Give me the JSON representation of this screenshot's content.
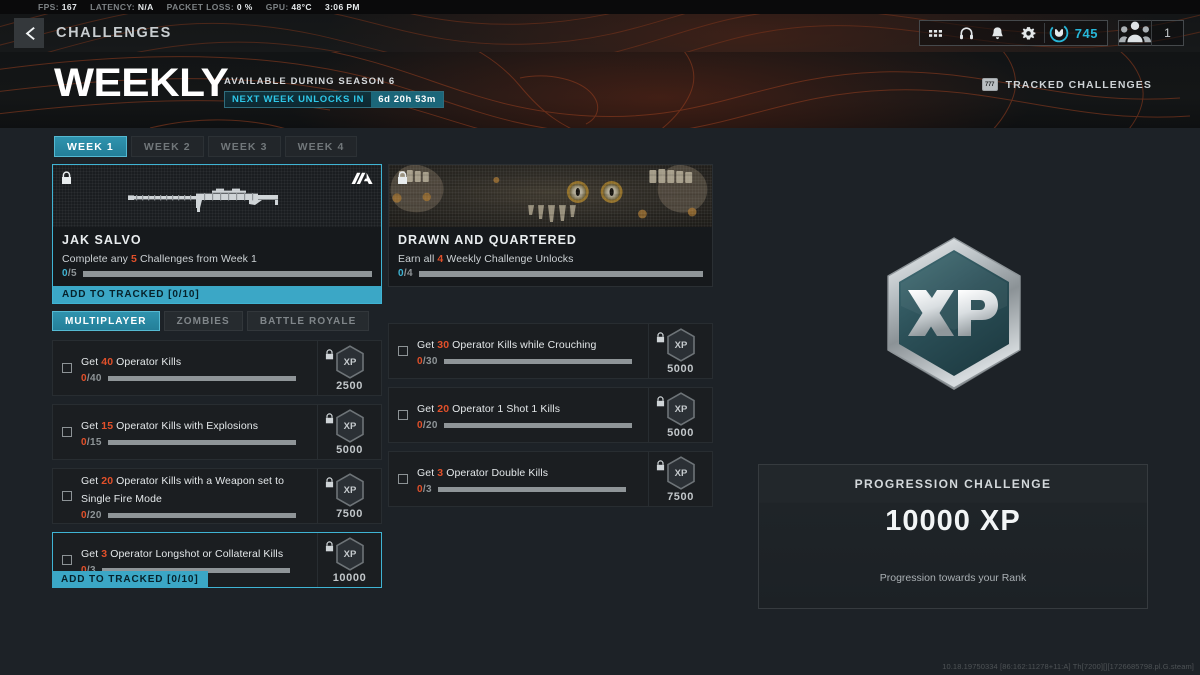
{
  "statusbar": {
    "fps_label": "FPS:",
    "fps_value": "167",
    "latency_label": "LATENCY:",
    "latency_value": "N/A",
    "packet_label": "PACKET LOSS:",
    "packet_value": "0 %",
    "gpu_label": "GPU:",
    "gpu_value": "48°C",
    "clock": "3:06 PM"
  },
  "header": {
    "back_icon": "chevron-left-icon",
    "title": "CHALLENGES",
    "icons": [
      "grid-apps-icon",
      "headphones-icon",
      "bell-icon",
      "gear-icon"
    ],
    "currency": {
      "icon": "cod-points-icon",
      "amount": "745"
    },
    "party": {
      "icon": "squad-icon",
      "count": "1"
    }
  },
  "hero": {
    "title": "WEEKLY",
    "availability": "AVAILABLE DURING SEASON 6",
    "timer_label": "NEXT WEEK UNLOCKS IN",
    "timer_value": "6d 20h 53m",
    "tracked_key": "777",
    "tracked_label": "TRACKED CHALLENGES"
  },
  "week_tabs": [
    {
      "label": "WEEK 1",
      "active": true
    },
    {
      "label": "WEEK 2",
      "active": false
    },
    {
      "label": "WEEK 3",
      "active": false
    },
    {
      "label": "WEEK 4",
      "active": false
    }
  ],
  "mode_tabs": [
    {
      "label": "MULTIPLAYER",
      "active": true
    },
    {
      "label": "ZOMBIES",
      "active": false
    },
    {
      "label": "BATTLE ROYALE",
      "active": false
    }
  ],
  "reward_cards": [
    {
      "name": "JAK SALVO",
      "description_pre": "Complete any ",
      "description_num": "5",
      "description_post": " Challenges from Week 1",
      "progress_current": "0",
      "progress_total": "/5",
      "progress_pct": 0,
      "lock_icon": "lock-icon",
      "rarity_icon": "rarity-badge-icon",
      "art": "weapon-jak-salvo",
      "selected": true,
      "track_label": "ADD TO TRACKED [0/10]"
    },
    {
      "name": "DRAWN AND QUARTERED",
      "description_pre": "Earn all ",
      "description_num": "4",
      "description_post": " Weekly Challenge Unlocks",
      "progress_current": "0",
      "progress_total": "/4",
      "progress_pct": 0,
      "lock_icon": "lock-icon",
      "art": "zombie-calling-card",
      "selected": false
    }
  ],
  "challenges_left": [
    {
      "title_pre": "Get ",
      "title_num": "40",
      "title_post": " Operator Kills",
      "progress_current": "0",
      "progress_total": "/40",
      "progress_pct": 0,
      "xp": "2500",
      "lock_icon": "lock-icon",
      "xp_icon": "xp-hex-icon",
      "checkbox": "unchecked",
      "selected": false
    },
    {
      "title_pre": "Get ",
      "title_num": "15",
      "title_post": " Operator Kills with Explosions",
      "progress_current": "0",
      "progress_total": "/15",
      "progress_pct": 0,
      "xp": "5000",
      "lock_icon": "lock-icon",
      "xp_icon": "xp-hex-icon",
      "checkbox": "unchecked",
      "selected": false
    },
    {
      "title_pre": "Get ",
      "title_num": "20",
      "title_post": " Operator Kills with a Weapon set to Single Fire Mode",
      "progress_current": "0",
      "progress_total": "/20",
      "progress_pct": 0,
      "xp": "7500",
      "lock_icon": "lock-icon",
      "xp_icon": "xp-hex-icon",
      "checkbox": "unchecked",
      "selected": false
    },
    {
      "title_pre": "Get ",
      "title_num": "3",
      "title_post": " Operator Longshot or Collateral Kills",
      "progress_current": "0",
      "progress_total": "/3",
      "progress_pct": 0,
      "xp": "10000",
      "lock_icon": "lock-icon",
      "xp_icon": "xp-hex-icon",
      "checkbox": "unchecked",
      "selected": true,
      "track_label": "ADD TO TRACKED [0/10]"
    }
  ],
  "challenges_right": [
    {
      "title_pre": "Get ",
      "title_num": "30",
      "title_post": " Operator Kills while Crouching",
      "progress_current": "0",
      "progress_total": "/30",
      "progress_pct": 0,
      "xp": "5000",
      "lock_icon": "lock-icon",
      "xp_icon": "xp-hex-icon",
      "checkbox": "unchecked",
      "selected": false
    },
    {
      "title_pre": "Get ",
      "title_num": "20",
      "title_post": " Operator 1 Shot 1 Kills",
      "progress_current": "0",
      "progress_total": "/20",
      "progress_pct": 0,
      "xp": "5000",
      "lock_icon": "lock-icon",
      "xp_icon": "xp-hex-icon",
      "checkbox": "unchecked",
      "selected": false
    },
    {
      "title_pre": "Get ",
      "title_num": "3",
      "title_post": " Operator Double Kills",
      "progress_current": "0",
      "progress_total": "/3",
      "progress_pct": 0,
      "xp": "7500",
      "lock_icon": "lock-icon",
      "xp_icon": "xp-hex-icon",
      "checkbox": "unchecked",
      "selected": false
    }
  ],
  "detail_panel": {
    "badge_icon": "xp-emblem-icon",
    "badge_text": "XP",
    "card_header": "PROGRESSION CHALLENGE",
    "card_value": "10000 XP",
    "card_sub": "Progression towards your Rank"
  },
  "footer": {
    "build": "10.18.19750334 [86:162:11278+11:A] Th[7200][][1726685798.pl.G.steam]"
  },
  "colors": {
    "accent_cyan": "#3fb4d4",
    "accent_orange": "#e2502a",
    "background": "#1d2227",
    "header_dark": "#141617"
  }
}
